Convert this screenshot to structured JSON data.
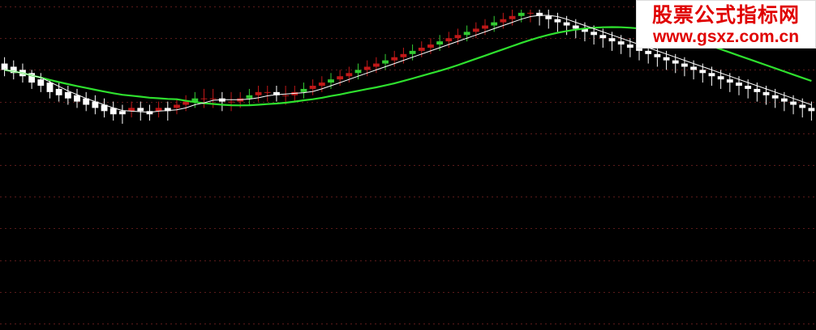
{
  "watermark": {
    "title": "股票公式指标网",
    "url": "www.gsxz.com.cn"
  },
  "chart_data": {
    "type": "candlestick",
    "grid": "horizontal dashed",
    "ylim": [
      0,
      100
    ],
    "colors": {
      "up": "#c01818",
      "up_light": "#f0e29a",
      "bull_alt": "#33cc33",
      "down": "#ffffff",
      "ma_long": "#2ee02e",
      "ma_short": "#ffffff",
      "signal": "#ff33ff",
      "bottom_mark": "#ff3030"
    },
    "signal_glyph": "×",
    "bottom_glyph": "≙",
    "candles": [
      [
        82,
        80,
        84,
        78
      ],
      [
        81,
        79,
        83,
        77
      ],
      [
        80,
        78,
        82,
        76
      ],
      [
        79,
        76,
        80,
        74
      ],
      [
        77,
        75,
        79,
        73
      ],
      [
        76,
        73,
        77,
        71
      ],
      [
        74,
        72,
        76,
        70
      ],
      [
        73,
        71,
        75,
        69
      ],
      [
        72,
        70,
        74,
        68
      ],
      [
        71,
        69,
        73,
        67
      ],
      [
        70,
        68,
        72,
        66
      ],
      [
        69,
        67,
        71,
        65
      ],
      [
        68,
        66,
        70,
        64
      ],
      [
        67,
        66,
        69,
        63
      ],
      [
        67,
        68,
        70,
        65
      ],
      [
        68,
        67,
        70,
        64
      ],
      [
        67,
        66,
        69,
        64
      ],
      [
        67,
        68,
        70,
        65
      ],
      [
        68,
        67,
        70,
        64
      ],
      [
        68,
        69,
        71,
        66
      ],
      [
        69,
        70,
        72,
        67
      ],
      [
        70,
        71,
        73,
        68
      ],
      [
        71,
        71,
        74,
        68
      ],
      [
        71,
        71,
        74,
        68
      ],
      [
        71,
        70,
        73,
        67
      ],
      [
        70,
        70,
        73,
        67
      ],
      [
        70,
        71,
        73,
        68
      ],
      [
        71,
        72,
        74,
        69
      ],
      [
        72,
        73,
        75,
        70
      ],
      [
        73,
        73,
        75,
        70
      ],
      [
        73,
        72,
        75,
        70
      ],
      [
        72,
        72,
        75,
        69
      ],
      [
        72,
        73,
        75,
        70
      ],
      [
        73,
        74,
        76,
        71
      ],
      [
        74,
        75,
        77,
        72
      ],
      [
        75,
        76,
        78,
        73
      ],
      [
        76,
        77,
        79,
        74
      ],
      [
        77,
        78,
        80,
        75
      ],
      [
        78,
        79,
        81,
        76
      ],
      [
        79,
        80,
        82,
        77
      ],
      [
        80,
        81,
        83,
        78
      ],
      [
        81,
        82,
        84,
        79
      ],
      [
        82,
        83,
        85,
        80
      ],
      [
        83,
        84,
        86,
        81
      ],
      [
        84,
        85,
        87,
        82
      ],
      [
        85,
        86,
        88,
        83
      ],
      [
        86,
        87,
        89,
        84
      ],
      [
        87,
        88,
        90,
        85
      ],
      [
        88,
        89,
        91,
        86
      ],
      [
        89,
        90,
        92,
        87
      ],
      [
        90,
        91,
        93,
        88
      ],
      [
        91,
        92,
        94,
        89
      ],
      [
        92,
        93,
        95,
        90
      ],
      [
        93,
        94,
        96,
        91
      ],
      [
        94,
        95,
        97,
        92
      ],
      [
        95,
        96,
        98,
        93
      ],
      [
        96,
        97,
        99,
        94
      ],
      [
        97,
        98,
        99,
        95
      ],
      [
        98,
        98,
        99,
        95
      ],
      [
        98,
        97,
        99,
        94
      ],
      [
        97,
        96,
        99,
        93
      ],
      [
        96,
        95,
        98,
        92
      ],
      [
        95,
        94,
        97,
        91
      ],
      [
        94,
        93,
        96,
        90
      ],
      [
        93,
        92,
        95,
        89
      ],
      [
        92,
        91,
        94,
        88
      ],
      [
        91,
        90,
        93,
        87
      ],
      [
        90,
        89,
        92,
        86
      ],
      [
        89,
        88,
        91,
        85
      ],
      [
        88,
        87,
        90,
        84
      ],
      [
        87,
        86,
        89,
        83
      ],
      [
        86,
        85,
        88,
        82
      ],
      [
        85,
        84,
        87,
        81
      ],
      [
        84,
        83,
        86,
        80
      ],
      [
        83,
        82,
        85,
        79
      ],
      [
        82,
        81,
        84,
        78
      ],
      [
        81,
        80,
        83,
        77
      ],
      [
        80,
        79,
        82,
        76
      ],
      [
        79,
        78,
        81,
        75
      ],
      [
        78,
        77,
        80,
        74
      ],
      [
        77,
        76,
        79,
        73
      ],
      [
        76,
        75,
        78,
        72
      ],
      [
        75,
        74,
        77,
        71
      ],
      [
        74,
        73,
        76,
        70
      ],
      [
        73,
        72,
        75,
        69
      ],
      [
        72,
        71,
        74,
        68
      ],
      [
        71,
        70,
        73,
        67
      ],
      [
        70,
        69,
        72,
        66
      ],
      [
        69,
        68,
        71,
        65
      ],
      [
        68,
        67,
        70,
        64
      ]
    ],
    "ma_long": [],
    "ma_short": []
  }
}
